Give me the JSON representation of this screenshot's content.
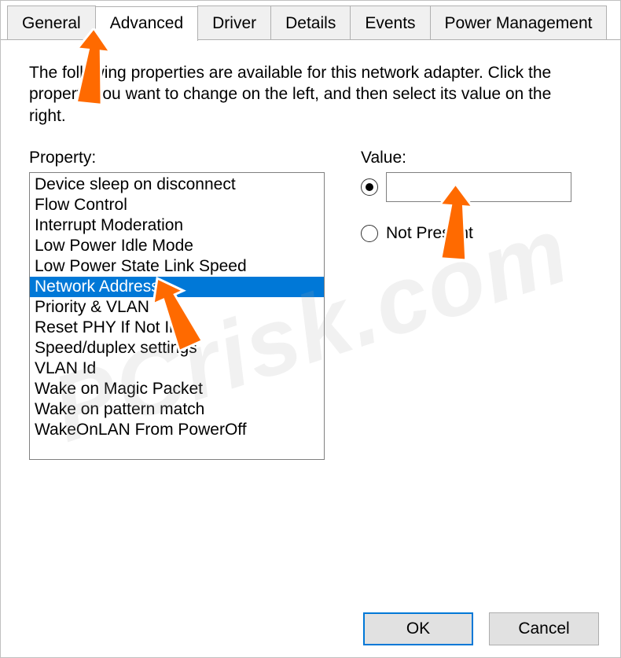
{
  "tabs": {
    "general": "General",
    "advanced": "Advanced",
    "driver": "Driver",
    "details": "Details",
    "events": "Events",
    "power": "Power Management"
  },
  "description": "The following properties are available for this network adapter. Click the property you want to change on the left, and then select its value on the right.",
  "labels": {
    "property": "Property:",
    "value": "Value:",
    "not_present": "Not Present"
  },
  "properties": [
    "Device sleep on disconnect",
    "Flow Control",
    "Interrupt Moderation",
    "Low Power Idle Mode",
    "Low Power State Link Speed",
    "Network Address",
    "Priority & VLAN",
    "Reset PHY If Not In",
    "Speed/duplex settings",
    "VLAN Id",
    "Wake on Magic Packet",
    "Wake on pattern match",
    "WakeOnLAN From PowerOff"
  ],
  "selected_property_index": 5,
  "value_input": "",
  "buttons": {
    "ok": "OK",
    "cancel": "Cancel"
  },
  "watermark": "PCrisk.com"
}
